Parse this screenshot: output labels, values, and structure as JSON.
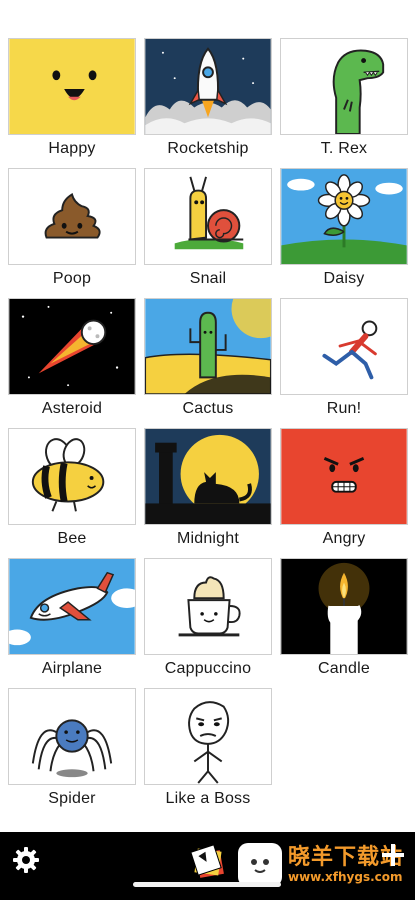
{
  "grid": {
    "items": [
      {
        "label": "Happy",
        "icon": "happy-face"
      },
      {
        "label": "Rocketship",
        "icon": "rocketship"
      },
      {
        "label": "T. Rex",
        "icon": "t-rex"
      },
      {
        "label": "Poop",
        "icon": "poop"
      },
      {
        "label": "Snail",
        "icon": "snail"
      },
      {
        "label": "Daisy",
        "icon": "daisy"
      },
      {
        "label": "Asteroid",
        "icon": "asteroid"
      },
      {
        "label": "Cactus",
        "icon": "cactus"
      },
      {
        "label": "Run!",
        "icon": "running-man"
      },
      {
        "label": "Bee",
        "icon": "bee"
      },
      {
        "label": "Midnight",
        "icon": "midnight-cat"
      },
      {
        "label": "Angry",
        "icon": "angry-face"
      },
      {
        "label": "Airplane",
        "icon": "airplane"
      },
      {
        "label": "Cappuccino",
        "icon": "cappuccino"
      },
      {
        "label": "Candle",
        "icon": "candle"
      },
      {
        "label": "Spider",
        "icon": "spider"
      },
      {
        "label": "Like a Boss",
        "icon": "like-a-boss"
      }
    ]
  },
  "toolbar": {
    "settings_icon": "gear-icon",
    "gallery_icon": "stack-icon",
    "add_icon": "plus-icon"
  },
  "watermark": {
    "title": "晓羊下载站",
    "url": "www.xfhygs.com"
  },
  "colors": {
    "happy_bg": "#f6d84a",
    "angry_bg": "#e8452f",
    "sky_blue": "#4aa7e6",
    "toolbar_bg": "#000000",
    "watermark_orange": "#f39a2b"
  }
}
